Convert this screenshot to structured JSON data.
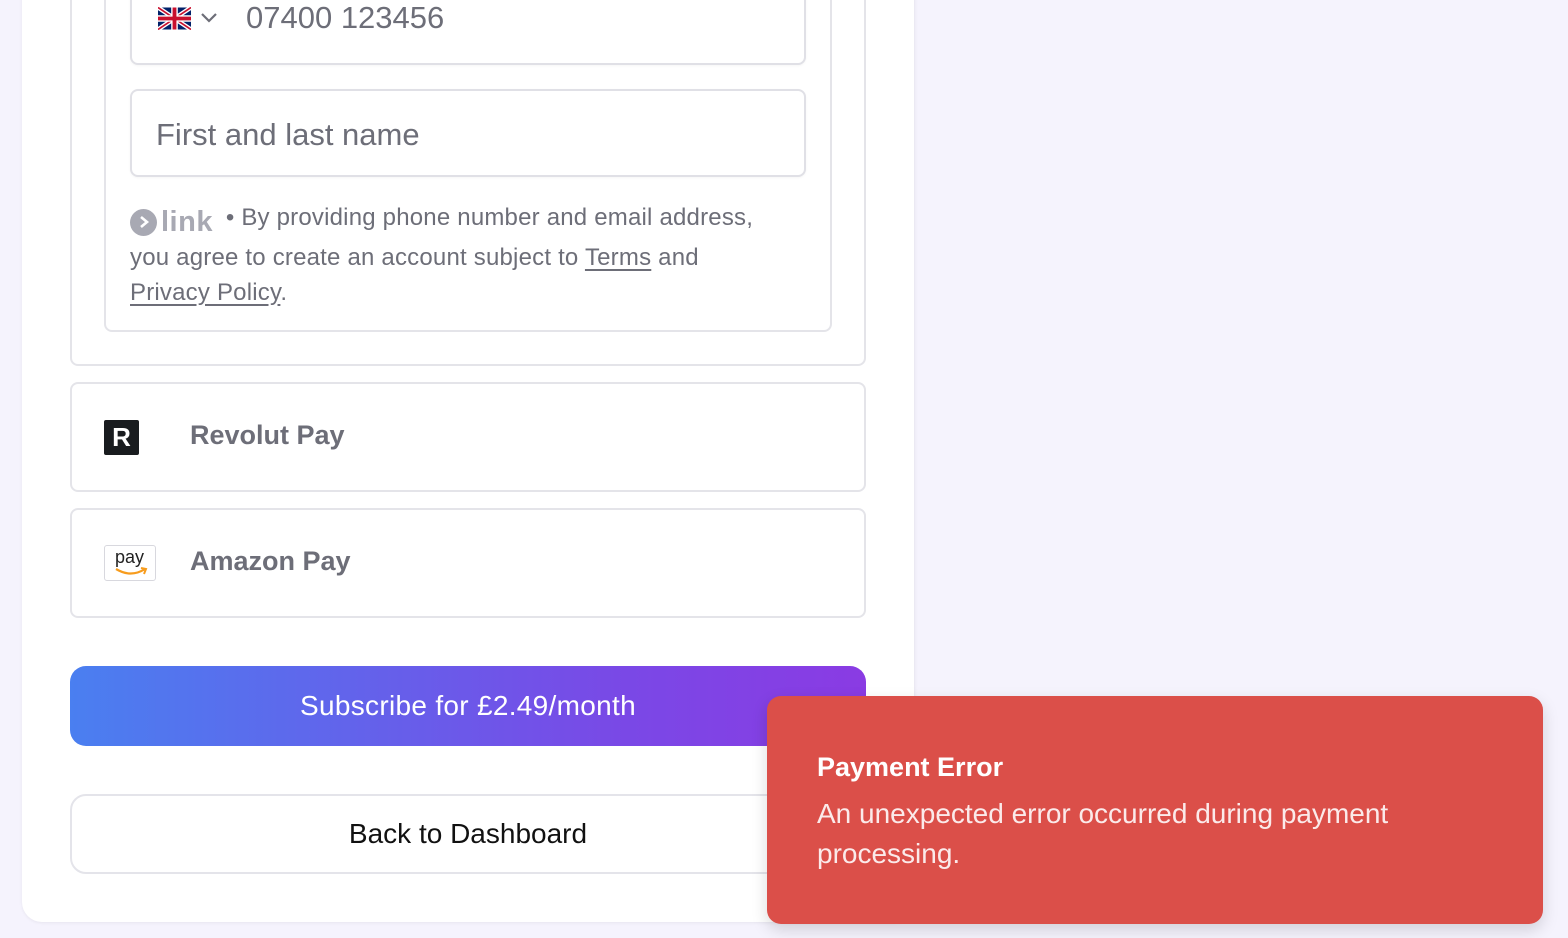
{
  "phone": {
    "country": "GB",
    "placeholder": "07400 123456"
  },
  "name": {
    "placeholder": "First and last name"
  },
  "link_legal": {
    "brand": "link",
    "bullet": "•",
    "text_before_terms": "By providing phone number and email address, you agree to create an account subject to",
    "terms_label": "Terms",
    "and": "and",
    "privacy_label": "Privacy Policy",
    "period": "."
  },
  "payment_methods": [
    {
      "label": "Revolut Pay",
      "icon": "revolut-icon",
      "icon_letter": "R"
    },
    {
      "label": "Amazon Pay",
      "icon": "amazon-pay-icon",
      "icon_text": "pay"
    }
  ],
  "buttons": {
    "subscribe": "Subscribe for £2.49/month",
    "back": "Back to Dashboard"
  },
  "toast": {
    "title": "Payment Error",
    "message": "An unexpected error occurred during payment processing."
  },
  "colors": {
    "background": "#f5f3fd",
    "gradient_start": "#4a7ff0",
    "gradient_end": "#8a3be3",
    "toast": "#db4f49",
    "muted_text": "#6d6e78"
  }
}
